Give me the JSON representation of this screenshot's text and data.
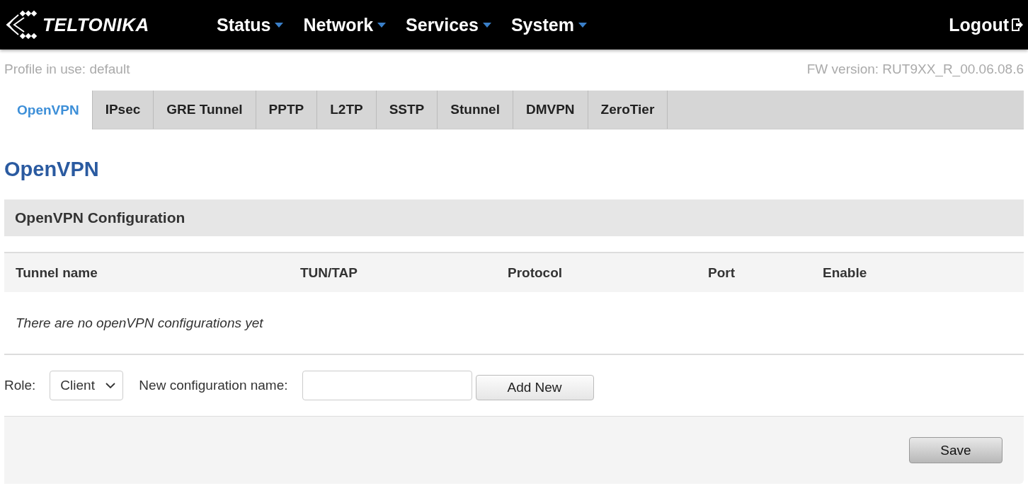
{
  "header": {
    "logo": "TELTONIKA",
    "menu": [
      {
        "label": "Status"
      },
      {
        "label": "Network"
      },
      {
        "label": "Services"
      },
      {
        "label": "System"
      }
    ],
    "logout": "Logout"
  },
  "info": {
    "profile": "Profile in use: default",
    "firmware": "FW version: RUT9XX_R_00.06.08.6"
  },
  "tabs": [
    {
      "label": "OpenVPN",
      "selected": true
    },
    {
      "label": "IPsec",
      "selected": false
    },
    {
      "label": "GRE Tunnel",
      "selected": false
    },
    {
      "label": "PPTP",
      "selected": false
    },
    {
      "label": "L2TP",
      "selected": false
    },
    {
      "label": "SSTP",
      "selected": false
    },
    {
      "label": "Stunnel",
      "selected": false
    },
    {
      "label": "DMVPN",
      "selected": false
    },
    {
      "label": "ZeroTier",
      "selected": false
    }
  ],
  "page_title": "OpenVPN",
  "section": {
    "title": "OpenVPN Configuration"
  },
  "table": {
    "columns": [
      "Tunnel name",
      "TUN/TAP",
      "Protocol",
      "Port",
      "Enable"
    ],
    "empty_message": "There are no openVPN configurations yet"
  },
  "form": {
    "role_label": "Role:",
    "role_value": "Client",
    "name_label": "New configuration name:",
    "add_button": "Add New"
  },
  "footer": {
    "save_button": "Save"
  }
}
